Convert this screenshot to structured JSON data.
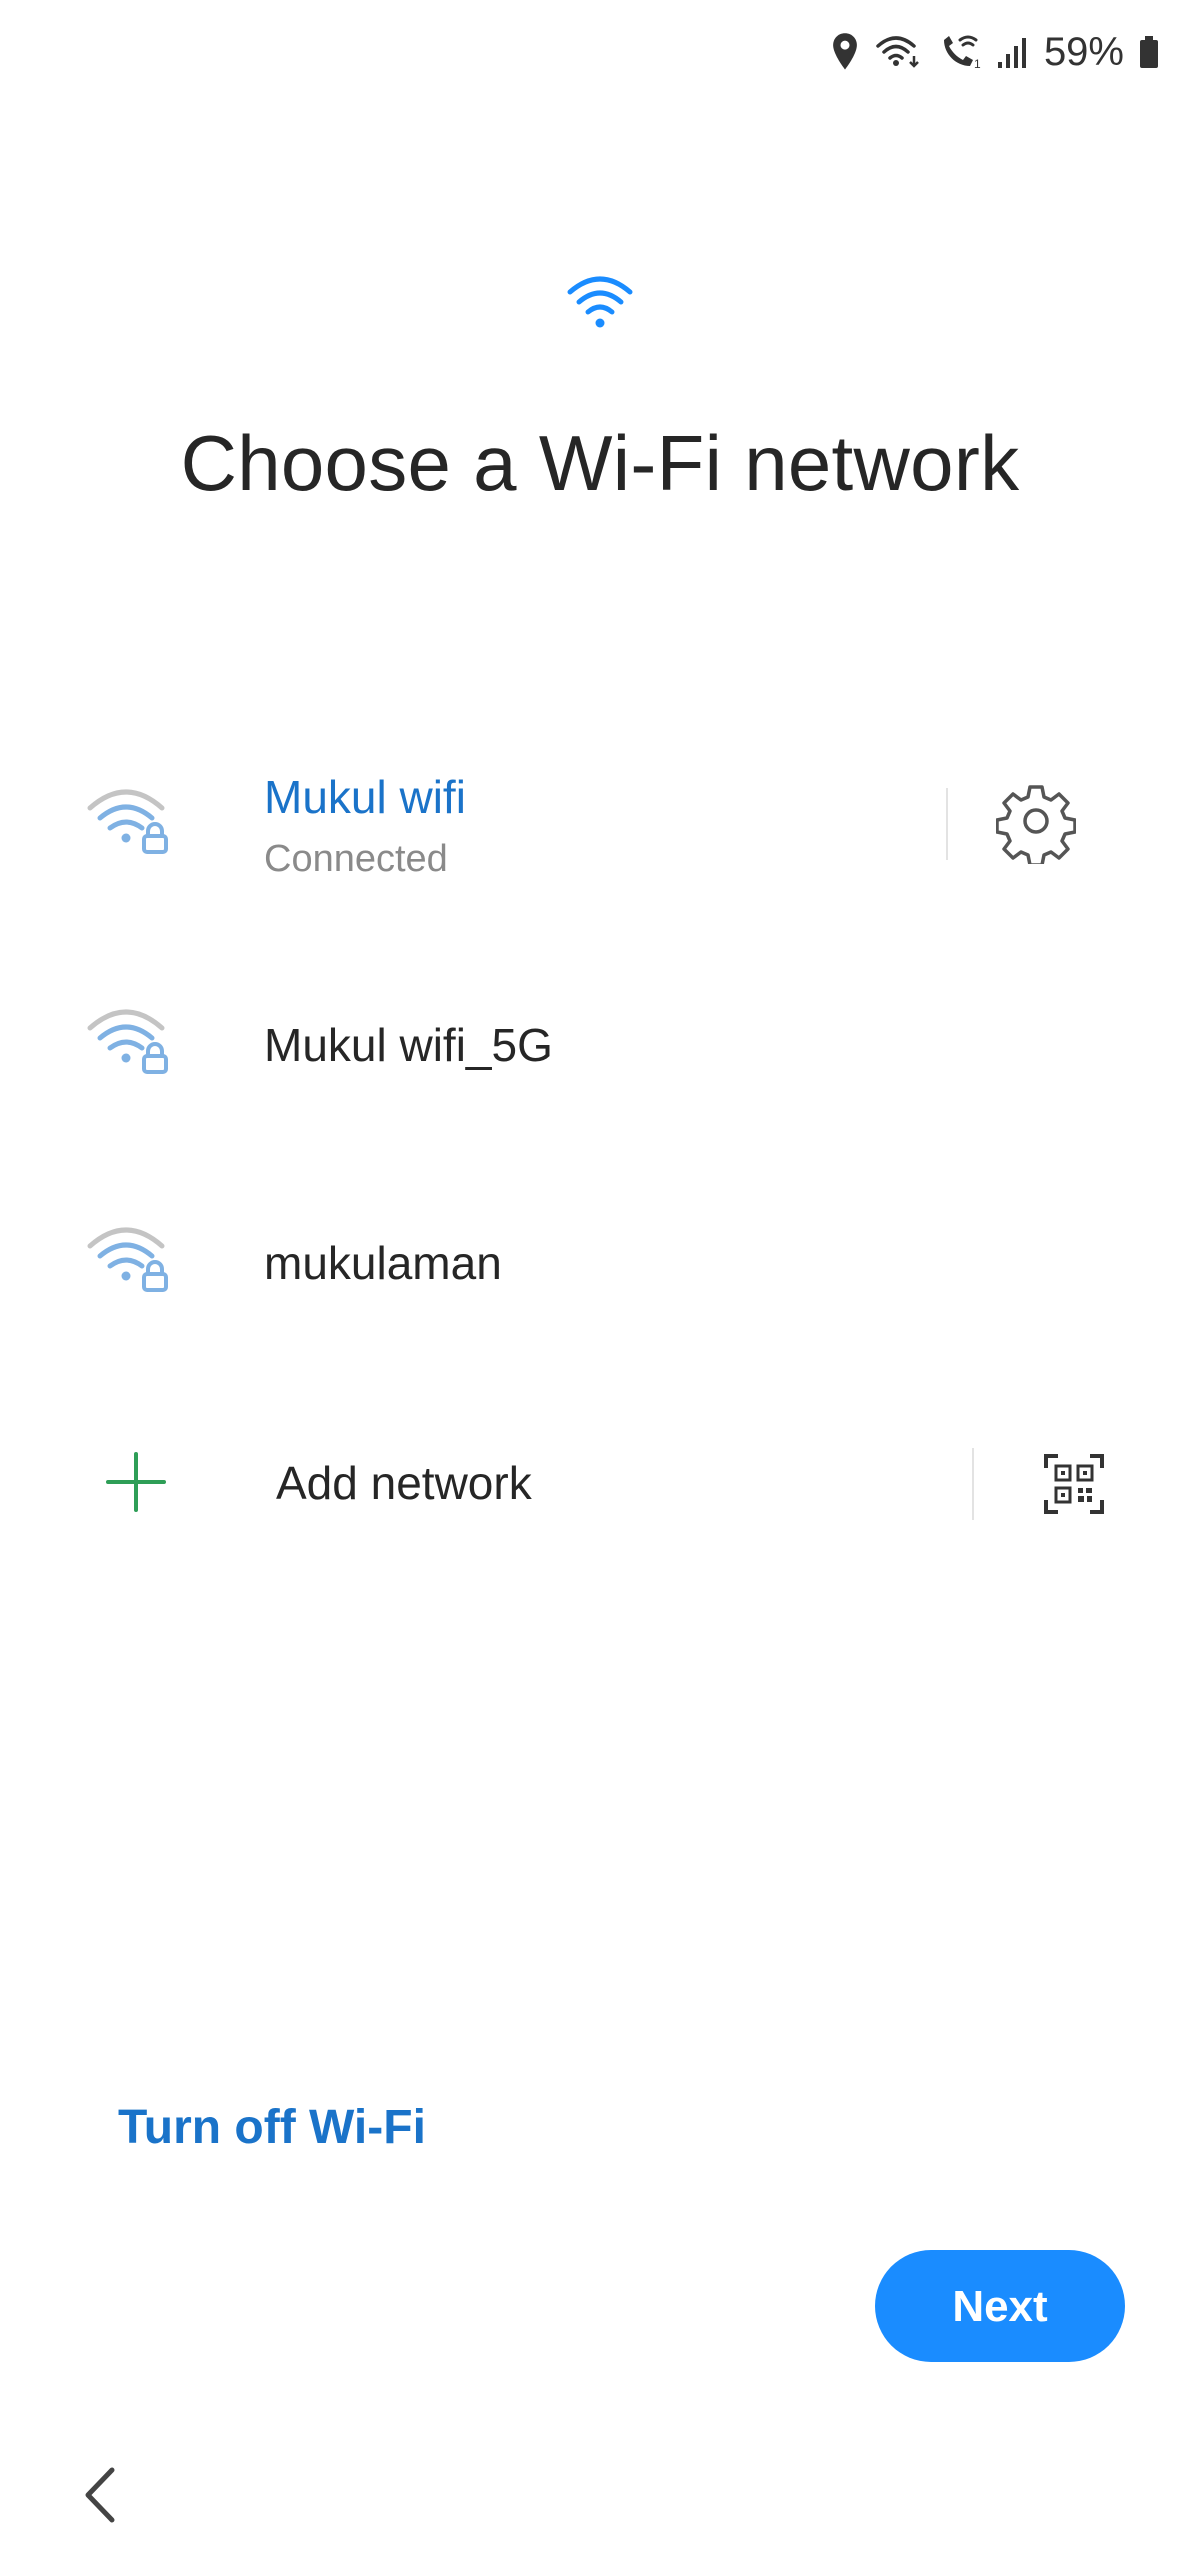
{
  "status_bar": {
    "icons": [
      "location-icon",
      "wifi-icon",
      "wifi-calling-icon",
      "signal-icon",
      "battery-icon"
    ],
    "battery_percent": "59%"
  },
  "header": {
    "icon": "wifi-icon",
    "title": "Choose a Wi-Fi network"
  },
  "networks": [
    {
      "name": "Mukul wifi",
      "status": "Connected",
      "secured": true,
      "connected": true
    },
    {
      "name": "Mukul wifi_5G",
      "status": "",
      "secured": true,
      "connected": false
    },
    {
      "name": "mukulaman",
      "status": "",
      "secured": true,
      "connected": false
    }
  ],
  "add_network": {
    "label": "Add network",
    "icon": "plus-icon",
    "qr_icon": "qr-code-icon"
  },
  "footer": {
    "turn_off_label": "Turn off Wi-Fi",
    "next_label": "Next",
    "back_icon": "chevron-left-icon"
  },
  "colors": {
    "accent": "#1a73c9",
    "button": "#1a8cff",
    "add_plus": "#2e9e57",
    "wifi_icon": "#7fb1e3"
  }
}
